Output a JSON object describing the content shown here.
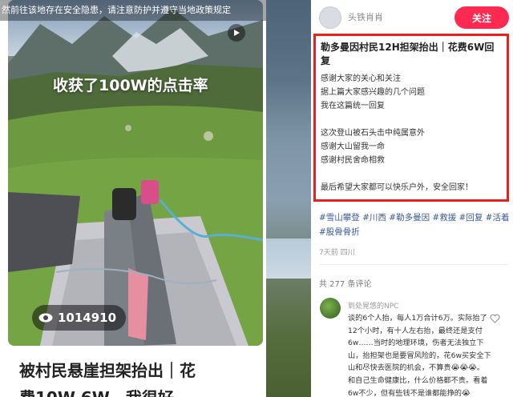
{
  "left_card": {
    "warning_text": "然前往该地存在安全隐患，请注意防护并遵守当地政策规定",
    "overlay_caption": "收获了100W的点击率",
    "view_count": "1014910",
    "title": "被村民悬崖担架抬出｜花",
    "title_line2": "费10W 6W，我很好"
  },
  "post": {
    "author": "头铁肖肖",
    "follow_label": "关注",
    "title": "勒多曼因村民12H担架抬出｜花费6W回复",
    "lines": [
      "感谢大家的关心和关注",
      "据上篇大家感兴趣的几个问题",
      "我在这篇统一回复",
      "",
      "这次登山被石头击中纯属意外",
      "感谢大山留我一命",
      "感谢村民舍命相救",
      "",
      "最后希望大家都可以快乐户外，安全回家！"
    ],
    "hashtags": "#雪山攀登 #川西 #勒多曼因 #救援 #回复 #活着 #股骨骨折",
    "meta": "7天前 四川",
    "comments_count": "共 277 条评论"
  },
  "comment": {
    "author": "到处晃悠的NPC",
    "lines": [
      "谈的6个人抬，每人1万合计6万。实际抬了",
      "12个小时，有十人左右抬，最终还是支付",
      "6w……当时的地理环境，伤者无法独立下",
      "山，抬担架也是要冒风险的，花6w买安全下",
      "山和尽快去医院的机会，不算贵😭😭😭。",
      "和自己生命健康比，什么价格都不贵。看着",
      "6w不少，但有些钱不是谁都能挣的😭"
    ]
  },
  "colors": {
    "accent": "#ff2a51",
    "highlight_border": "#e8211b",
    "hashtag": "#3b5998"
  }
}
